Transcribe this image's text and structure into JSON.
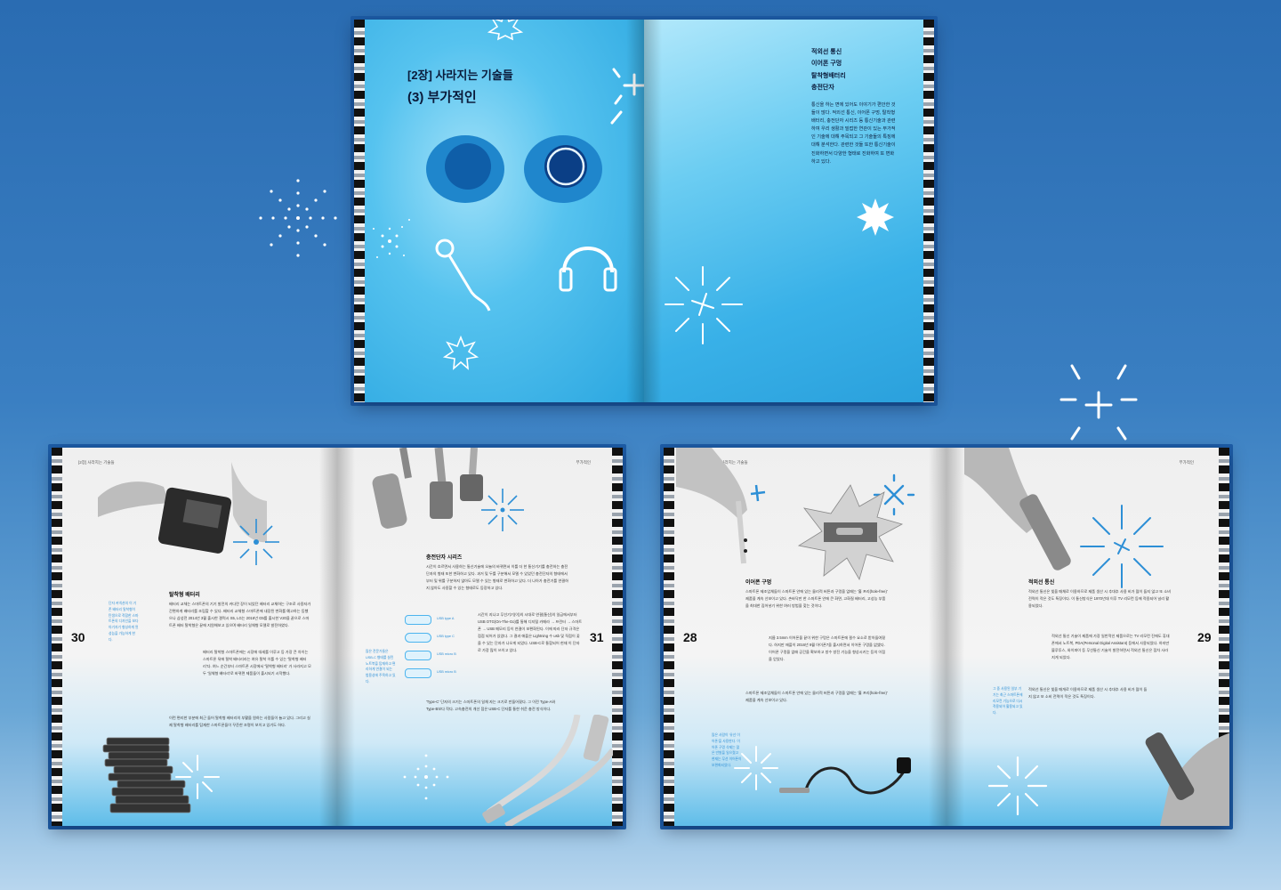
{
  "top_spread": {
    "chapter_label": "[2장] 사라지는 기술들",
    "chapter_title": "(3) 부가적인",
    "side_heading_lines": [
      "적외선 통신",
      "이어폰 구멍",
      "탈착형배터리",
      "충전단자"
    ],
    "side_body": "통신을 하는 면에 있어도 이야기가 편안한 것들이 많다. 적외선 통신, 이어폰 구멍, 탈착형 배터리, 충전단자 시리즈 등 통신기술과 관련하여 우리 생활과 밀접한 연관이 있는 부가적인 기술에 대해 주목되고 그 기술들의 특징에 대해 분석한다. 관련한 것들 또한 통신기술이 진화하면서 다양한 형태로 진화하여 또 변화하고 있다."
  },
  "left_spread": {
    "running_head": "[2장] 사라지는 기술들",
    "running_head_right": "부가적인",
    "page_left": "30",
    "page_right": "31",
    "section_battery": "탈착형 배터리",
    "battery_body": "배터리 교체는 스마트폰의 기기 발전의 커다란 장이 되었던 배터리 교체하는 구조로 사용자가 간편하게 배터리를 조립할 수 있다. 배터리 교체형 스마트폰에 내장된 변화를 예고하는 등했으나 삼성전 2014년 3월 출시한 갤럭시 S5, LG는 2016년 G5를 출시한 V20을 끝으로 스마트폰 배터 탈착형은 끝에 지원해보고 있으며 배터리 일체형 모델로 발전하였다.",
    "battery_body2": "배터리 탈착형 스마트폰에는 시장에 대세를 이루고 등 가장 큰 차이는 스마트폰 뒤에 탈착 배터리라는 여유 탈착 이를 수 있는 '탈착형 배터리'다. 여느 순간부터 스마트폰 시장에서 '탈착형 배터리' 가 사라지고 모두 '일체형 배터리'로 바뀌면 제품들이 출시되기 시작했다.",
    "battery_body3": "이런 편리한 부분에 최근 들어 탈착형 배터리의 부활을 원하는 사람들이 늘고 있다. 그리고 실제 탈착형 배터리를 탑재한 스마트폰들이 꾸준한 조명이 보이고 있기도 하다.",
    "side_note_left": "단자 커넥션의 이 기존 배터리 탈착형이 탄생으로 적합한 스마트폰의 디자인을 보다 아기자기 형성하게 된 성능을 가능하게 한다.",
    "section_charger": "충전단자 시리즈",
    "charger_body": "시간이 흐르면서 사용하는 통신기술에 오늘의 바뀌면서 이를 더 한 통신기기를 충전하는 충전단자의 형태 또한 변화하고 있다. 과거 및 두를 구분해서 모델 수 있었던 충전단자의 형태에서 부터 및 위를 구분하지 않아도 모델 수 있는 형태로 변화하고 있다. 더 나아가 충전기를 연결하지 않아도 사용할 수 있는 형태로도 등장하고 있다.",
    "charger_body2": "시간이 지나고 무선기기(이)의 시대로 연결(통신)의 일급에서부터 USB OTG(On-The-Go)를 통해 디지털 카메라 → 프린터 → 스마트폰 → USB 메모리 등이 연결이 보편화된다. 이에 따라 단자 규격은 점점 되어가 있었다. 그 결과 애플은 Lightning 수 usb 및 직접이 꽂을 수 있는 단자가 나오게 되었다. USB-C로 통합되어 현재 이 단자로 가장 많이 쓰이고 있다.",
    "usb_labels": [
      "USB type A",
      "USB type C",
      "USB micro B",
      "USB micro B"
    ],
    "charger_body3": "'Type-C' 단자의 크기는 스마트폰의 일체 자는 크기로 만들어졌다. 그 이전 Type-A와 Type-B보다 작다. 고속충전의 개선 점은 USB-C 단자를 통한 쉬운 충전 방식이다.",
    "side_note_right": "많은 전문가들은 USB-C 형태를 살린 노트북을 탑재하고 편리하게 연결이 되는 범용성에 주목하고 있다."
  },
  "right_spread": {
    "running_head": "[2장] 사라지는 기술들",
    "running_head_right": "부가적인",
    "page_left": "28",
    "page_right": "29",
    "section_earphone": "이어폰 구멍",
    "earphone_body": "스마트폰 제조업체들이 스마트폰 안에 있는 물리적 버튼과 구멍을 없애는 '홀 프리(hole-free)' 제품을 계속 선보이고 있다. 손바닥만 한 스마트폰 안에 큰 화면, 고화질 배터리, 고성능 부품을 최대한 집어넣기 위한 여러 방법을 찾는 것이다.",
    "earphone_body2": "지름 3.5mm 이어폰을 끝이 위한 구멍은 스마트폰에 필수 요소로 받아들여졌다. 하지만 애플이 2016년 9월 아이폰7을 출시하면서 이어폰 구멍을 없앴다. 이어폰 구멍을 없애 공간을 확보하고 방수 방진 기능을 향상시키는 등의 이점을 얻었다.",
    "earphone_body3": "스마트폰 제조업체들이 스마트폰 안에 있는 물리적 버튼과 구멍을 없애는 '홀 프리(hole-free)' 제품을 계속 선보이고 있다.",
    "side_note_left": "많은 사람이 '유선 이어폰'을 사용한다. 이어폰 구멍 삭제는 많은 반발을 일으켰고 현재는 무선 이어폰이 보편화되었다.",
    "section_ir": "적외선 통신",
    "ir_body": "적외선 통신은 빛을 매체로 이용하므로 제품 생산 시 추대추 사용 비가 많이 들지 않고 또 소비 전력이 적은 것도 특징이다. 이 통신방식은 1970년대 이후 TV 리모컨 등에 적용되어 널리 활용되었다.",
    "ir_body2": "적외선 통신 기술이 제품에 가장 일반적인 제품으로는 TV 리모컨 진에도 휴대폰에서 노트북, PDA(Personal Digital Assistant) 등에서 사용되었다. 하지만 블루투스, 와이파이 등 무선통신 기술이 발전하면서 적외선 통신은 점차 사라지게 되었다.",
    "ir_body3": "적외선 통신은 빛을 매개로 이용하므로 제품 생산 시 추대추 사용 비가 많이 들지 않고 또 소비 전력이 적은 것도 특징이다.",
    "side_note_right": "그 중 사용된 일부 기기는 최근 스마트폰에 리모컨 기능으로 다시 적용되어 활용되고 있다."
  }
}
